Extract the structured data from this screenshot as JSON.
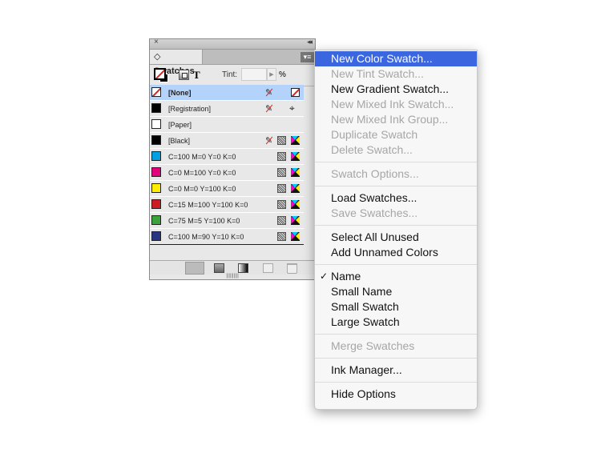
{
  "panel": {
    "close": "×",
    "collapse": "◂◂",
    "tab_label": "◇ Swatches",
    "menu_button": "▾≡",
    "tint_label": "Tint:",
    "tint_value": "",
    "tint_arrow": "▶",
    "percent": "%",
    "t_label": "T",
    "grip": "||||||||||",
    "swatches": [
      {
        "name": "[None]",
        "color": "none",
        "selected": true,
        "noedit": true,
        "right": "none-icon"
      },
      {
        "name": "[Registration]",
        "color": "#000000",
        "noedit": true,
        "right": "registration-icon"
      },
      {
        "name": "[Paper]",
        "color": "#ffffff",
        "right": ""
      },
      {
        "name": "[Black]",
        "color": "#000000",
        "noedit": true,
        "right": "cmyk"
      },
      {
        "name": "C=100 M=0 Y=0 K=0",
        "color": "#009fe3",
        "right": "cmyk"
      },
      {
        "name": "C=0 M=100 Y=0 K=0",
        "color": "#e4007d",
        "right": "cmyk"
      },
      {
        "name": "C=0 M=0 Y=100 K=0",
        "color": "#ffed00",
        "right": "cmyk"
      },
      {
        "name": "C=15 M=100 Y=100 K=0",
        "color": "#cc1b22",
        "right": "cmyk"
      },
      {
        "name": "C=75 M=5 Y=100 K=0",
        "color": "#3aa23b",
        "right": "cmyk"
      },
      {
        "name": "C=100 M=90 Y=10 K=0",
        "color": "#283582",
        "right": "cmyk"
      }
    ]
  },
  "menu": {
    "groups": [
      [
        {
          "label": "New Color Swatch...",
          "enabled": true,
          "highlighted": true
        },
        {
          "label": "New Tint Swatch...",
          "enabled": false
        },
        {
          "label": "New Gradient Swatch...",
          "enabled": true
        },
        {
          "label": "New Mixed Ink Swatch...",
          "enabled": false
        },
        {
          "label": "New Mixed Ink Group...",
          "enabled": false
        },
        {
          "label": "Duplicate Swatch",
          "enabled": false
        },
        {
          "label": "Delete Swatch...",
          "enabled": false
        }
      ],
      [
        {
          "label": "Swatch Options...",
          "enabled": false
        }
      ],
      [
        {
          "label": "Load Swatches...",
          "enabled": true
        },
        {
          "label": "Save Swatches...",
          "enabled": false
        }
      ],
      [
        {
          "label": "Select All Unused",
          "enabled": true
        },
        {
          "label": "Add Unnamed Colors",
          "enabled": true
        }
      ],
      [
        {
          "label": "Name",
          "enabled": true,
          "checked": true
        },
        {
          "label": "Small Name",
          "enabled": true
        },
        {
          "label": "Small Swatch",
          "enabled": true
        },
        {
          "label": "Large Swatch",
          "enabled": true
        }
      ],
      [
        {
          "label": "Merge Swatches",
          "enabled": false
        }
      ],
      [
        {
          "label": "Ink Manager...",
          "enabled": true
        }
      ],
      [
        {
          "label": "Hide Options",
          "enabled": true
        }
      ]
    ],
    "checkmark": "✓",
    "highlight_color": "#3a66e0"
  }
}
